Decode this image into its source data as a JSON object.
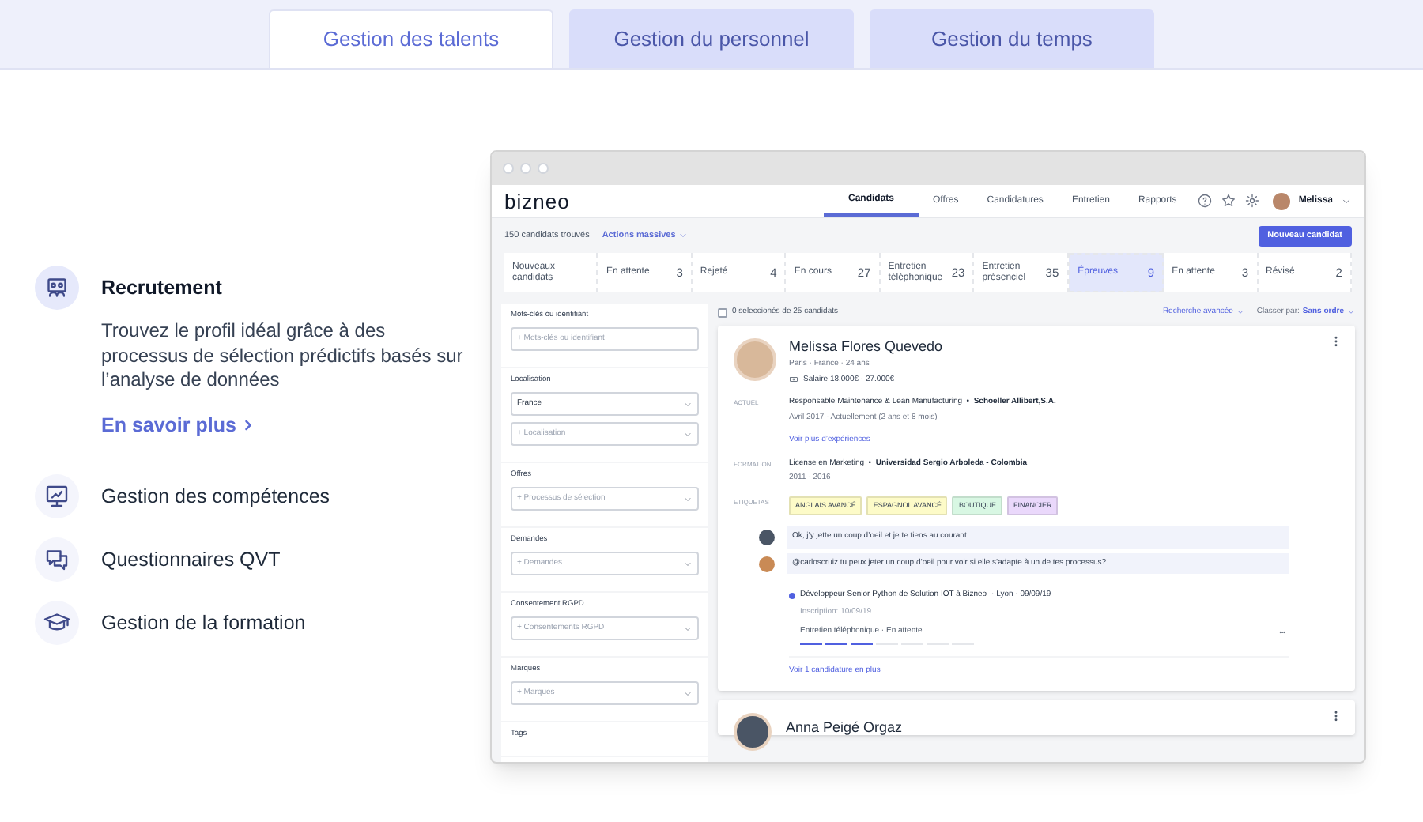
{
  "top_tabs": [
    {
      "label": "Gestion des talents",
      "selected": true
    },
    {
      "label": "Gestion du personnel",
      "selected": false
    },
    {
      "label": "Gestion du temps",
      "selected": false
    }
  ],
  "features": [
    {
      "title": "Recrutement",
      "selected": true,
      "description": "Trouvez le profil idéal grâce à des processus de sélection prédictifs basés sur l’analyse de données",
      "link": "En savoir plus"
    },
    {
      "title": "Gestion des compétences",
      "selected": false
    },
    {
      "title": "Questionnaires QVT",
      "selected": false
    },
    {
      "title": "Gestion de la formation",
      "selected": false
    }
  ],
  "app": {
    "logo": "bizneo",
    "nav": [
      {
        "label": "Candidats",
        "selected": true
      },
      {
        "label": "Offres",
        "selected": false
      },
      {
        "label": "Candidatures",
        "selected": false
      },
      {
        "label": "Entretien",
        "selected": false
      },
      {
        "label": "Rapports",
        "selected": false
      }
    ],
    "user": "Melissa",
    "found": "150 candidats trouvés",
    "mass_actions": "Actions massives",
    "new_button": "Nouveau candidat",
    "stages": [
      {
        "label": "Nouveaux candidats",
        "selected": false
      },
      {
        "label": "En attente",
        "count": "3",
        "selected": false
      },
      {
        "label": "Rejeté",
        "count": "4",
        "selected": false
      },
      {
        "label": "En cours",
        "count": "27",
        "selected": false
      },
      {
        "label": "Entretien téléphonique",
        "count": "23",
        "selected": false
      },
      {
        "label": "Entretien présenciel",
        "count": "35",
        "selected": false
      },
      {
        "label": "Épreuves",
        "count": "9",
        "selected": true
      },
      {
        "label": "En attente",
        "count": "3",
        "selected": false
      },
      {
        "label": "Révisé",
        "count": "2",
        "selected": false
      }
    ],
    "filters": [
      {
        "label": "Mots-clés ou identifiant",
        "fields": [
          {
            "kind": "input",
            "placeholder": "+ Mots-clés ou identifiant"
          }
        ]
      },
      {
        "label": "Localisation",
        "fields": [
          {
            "kind": "select",
            "value": "France"
          },
          {
            "kind": "select",
            "placeholder": "+ Localisation"
          }
        ]
      },
      {
        "label": "Offres",
        "fields": [
          {
            "kind": "select",
            "placeholder": "+ Processus de sélection"
          }
        ]
      },
      {
        "label": "Demandes",
        "fields": [
          {
            "kind": "select",
            "placeholder": "+ Demandes"
          }
        ]
      },
      {
        "label": "Consentement RGPD",
        "fields": [
          {
            "kind": "select",
            "placeholder": "+ Consentements RGPD"
          }
        ]
      },
      {
        "label": "Marques",
        "fields": [
          {
            "kind": "select",
            "placeholder": "+ Marques"
          }
        ]
      },
      {
        "label": "Tags"
      }
    ],
    "selection": {
      "label": "0 seleccionés de 25 candidats",
      "checked": false
    },
    "advanced": "Recherche avancée",
    "sort_label": "Classer par:",
    "sort_value": "Sans ordre",
    "candidates": [
      {
        "name": "Melissa Flores Quevedo",
        "location": "Paris · France · 24 ans",
        "salary": "Salaire 18.000€ - 27.000€",
        "current": {
          "label": "ACTUEL",
          "text": "Responsable Maintenance & Lean Manufacturing  •  **Schoeller Allibert,S.A.**",
          "dates": "Avril 2017 - Actuellement (2 ans et 8 mois)",
          "link": "Voir plus d’expériences"
        },
        "education": {
          "label": "FORMATION",
          "text": "License en Marketing  •  **Universidad Sergio Arboleda - Colombia**",
          "dates": "2011 - 2016"
        },
        "tags_label": "ETIQUETAS",
        "tags": [
          {
            "label": "ANGLAIS AVANCÉ",
            "color": "#fdfbc8"
          },
          {
            "label": "ESPAGNOL AVANCÉ",
            "color": "#fdfbc8"
          },
          {
            "label": "BOUTIQUE",
            "color": "#d8f7e3"
          },
          {
            "label": "FINANCIER",
            "color": "#ead8fb"
          }
        ],
        "comments": [
          "Ok, j’y jette un coup d’oeil et je te tiens au courant.",
          "@carloscruiz tu peux jeter un coup d’oeil pour voir si elle s’adapte à un de tes processus?"
        ],
        "application": {
          "title": "Développeur Senior Python de Solution IOT à Bizneo",
          "meta": "· Lyon · 09/09/19",
          "inscription": "Inscription: 10/09/19",
          "status": "Entretien téléphonique · En attente",
          "steps": [
            {
              "done": true
            },
            {
              "done": true
            },
            {
              "done": true
            },
            {
              "done": false
            },
            {
              "done": false
            },
            {
              "done": false
            },
            {
              "done": false
            }
          ]
        },
        "more_link": "Voir 1 candidature en plus"
      },
      {
        "name": "Anna Peigé Orgaz"
      }
    ]
  }
}
